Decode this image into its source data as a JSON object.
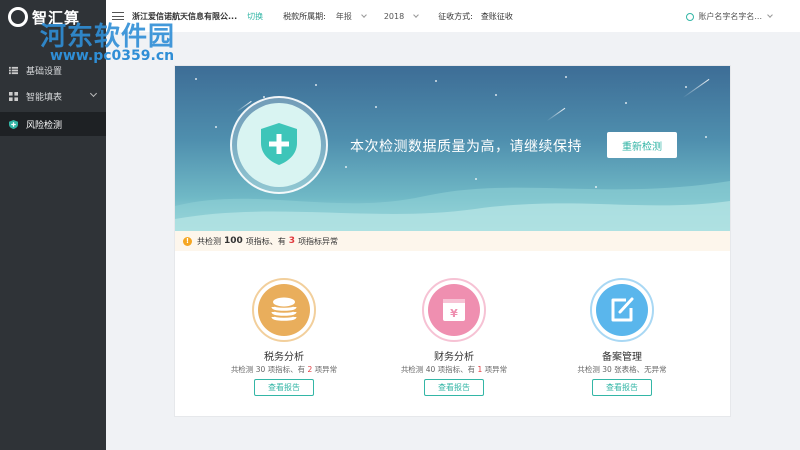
{
  "sidebar": {
    "logo_text": "智汇算",
    "items": [
      {
        "label": "基础设置",
        "icon": "list-icon"
      },
      {
        "label": "智能填表",
        "icon": "grid-icon"
      },
      {
        "label": "风险检测",
        "icon": "shield-icon",
        "active": true
      }
    ]
  },
  "watermark": {
    "text": "河东软件园",
    "url": "www.pc0359.cn"
  },
  "header": {
    "company": "浙江爱信诺航天信息有限公...",
    "switch_label": "切换",
    "period_label": "税款所属期:",
    "period_type": "年报",
    "year": "2018",
    "collection_label": "征收方式:",
    "collection_value": "查账征收",
    "account": "账户名字名字名..."
  },
  "banner": {
    "message": "本次检测数据质量为高，请继续保持",
    "recheck_label": "重新检测"
  },
  "notice": {
    "prefix": "共检测",
    "total": "100",
    "middle": "项指标、有",
    "abnormal": "3",
    "suffix": "项指标异常"
  },
  "features": [
    {
      "title": "税务分析",
      "desc_prefix": "共检测 30 项指标、有 ",
      "count": "2",
      "desc_suffix": " 项异常",
      "button": "查看报告",
      "color": "#e9ae5c",
      "icon": "coins-icon"
    },
    {
      "title": "财务分析",
      "desc_prefix": "共检测 40 项指标、有 ",
      "count": "1",
      "desc_suffix": " 项异常",
      "button": "查看报告",
      "color": "#ef8fb0",
      "icon": "yen-box-icon"
    },
    {
      "title": "备案管理",
      "desc_prefix": "共检测 30 张表格、无异常",
      "count": "",
      "desc_suffix": "",
      "button": "查看报告",
      "color": "#5ab6ec",
      "icon": "edit-icon"
    }
  ]
}
